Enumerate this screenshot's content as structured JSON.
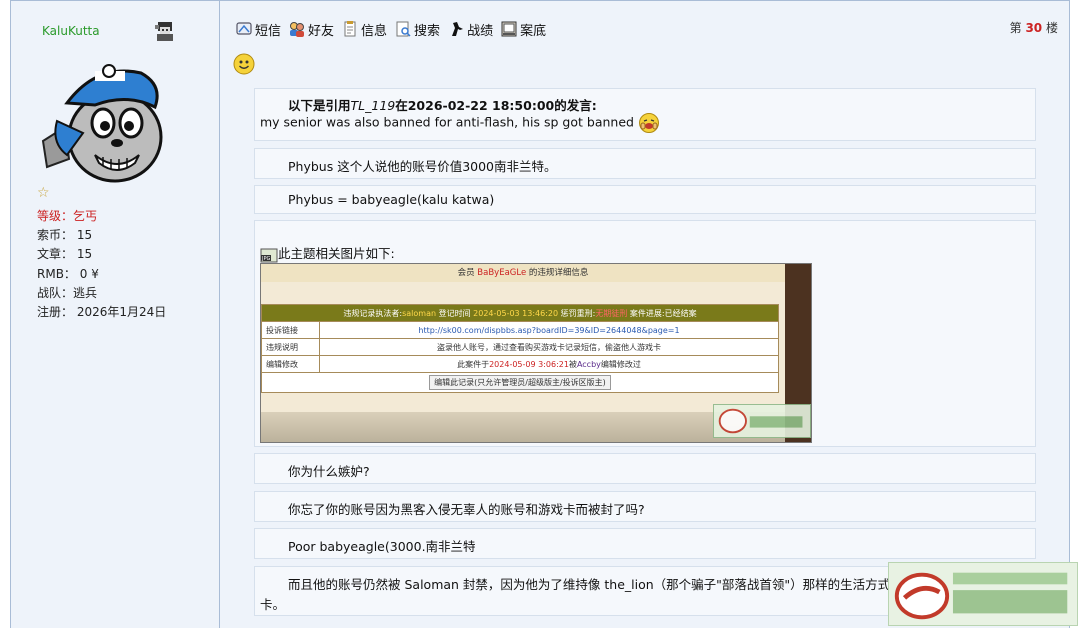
{
  "user": {
    "name": "KaluKutta",
    "rank_label": "等级：乞丐",
    "coins": "索币：  15",
    "posts": "文章：  15",
    "rmb": "RMB：  0 ¥",
    "team": "战队：逃兵",
    "registered": "注册：  2026年1月24日"
  },
  "toolbar": {
    "items": [
      {
        "label": "短信",
        "icon": "message-icon"
      },
      {
        "label": "好友",
        "icon": "friends-icon"
      },
      {
        "label": "信息",
        "icon": "info-icon"
      },
      {
        "label": "搜索",
        "icon": "search-icon"
      },
      {
        "label": "战绩",
        "icon": "record-icon"
      },
      {
        "label": "案底",
        "icon": "file-icon"
      }
    ]
  },
  "floor": {
    "prefix": "第",
    "number": "30",
    "suffix": "楼"
  },
  "post": {
    "quote_prefix": "以下是引用",
    "quote_user": "TL_119",
    "quote_time": "在2026-02-22 18:50:00的发言:",
    "quote_text": "my senior was also banned for anti-flash, his sp got banned",
    "p1": "Phybus 这个人说他的账号价值3000南非兰特。",
    "p2": "Phybus = babyeagle(kalu katwa)",
    "attach_label": "此主题相关图片如下:",
    "p3": "你为什么嫉妒?",
    "p4": "你忘了你的账号因为黑客入侵无辜人的账号和游戏卡而被封了吗?",
    "p5": "Poor babyeagle(3000.南非兰特",
    "p6a": "而且他的账号仍然被 Saloman 封禁，因为他为了维持像 the_lion（那个骗子\"部落战首领\"）那样的生活方式，偷了无辜人的账号和",
    "p6b": "卡。"
  },
  "attachment": {
    "title_pre": "会员",
    "title_user": "BaBy​EaGLe",
    "title_post": "的违规详细信息",
    "header_pre": "违规记录执法者:",
    "header_enforcer": "saloman",
    "header_mid": " 登记时间 ",
    "header_time": "2024-05-03 13:46:20",
    "header_penalty_label": " 惩罚重刑:",
    "header_penalty": "无期徒刑",
    "header_status": " 案件进展:已经结案",
    "row1_label": "投诉链接",
    "row1_value": "http://sk00.com/dispbbs.asp?boardID=39&ID=2644048&page=1",
    "row2_label": "违规说明",
    "row2_value": "盗录他人账号，通过查看购买游戏卡记录短信，偷盗他人游戏卡",
    "row3_label": "编辑修改",
    "row3_pre": "此案件于",
    "row3_date": "2024-05-09 3:06:21",
    "row3_mid": "被",
    "row3_user": "Accby",
    "row3_post": "编辑修改过",
    "edit_button": "编辑此记录(只允许管理员/超级版主/投诉区版主)"
  }
}
